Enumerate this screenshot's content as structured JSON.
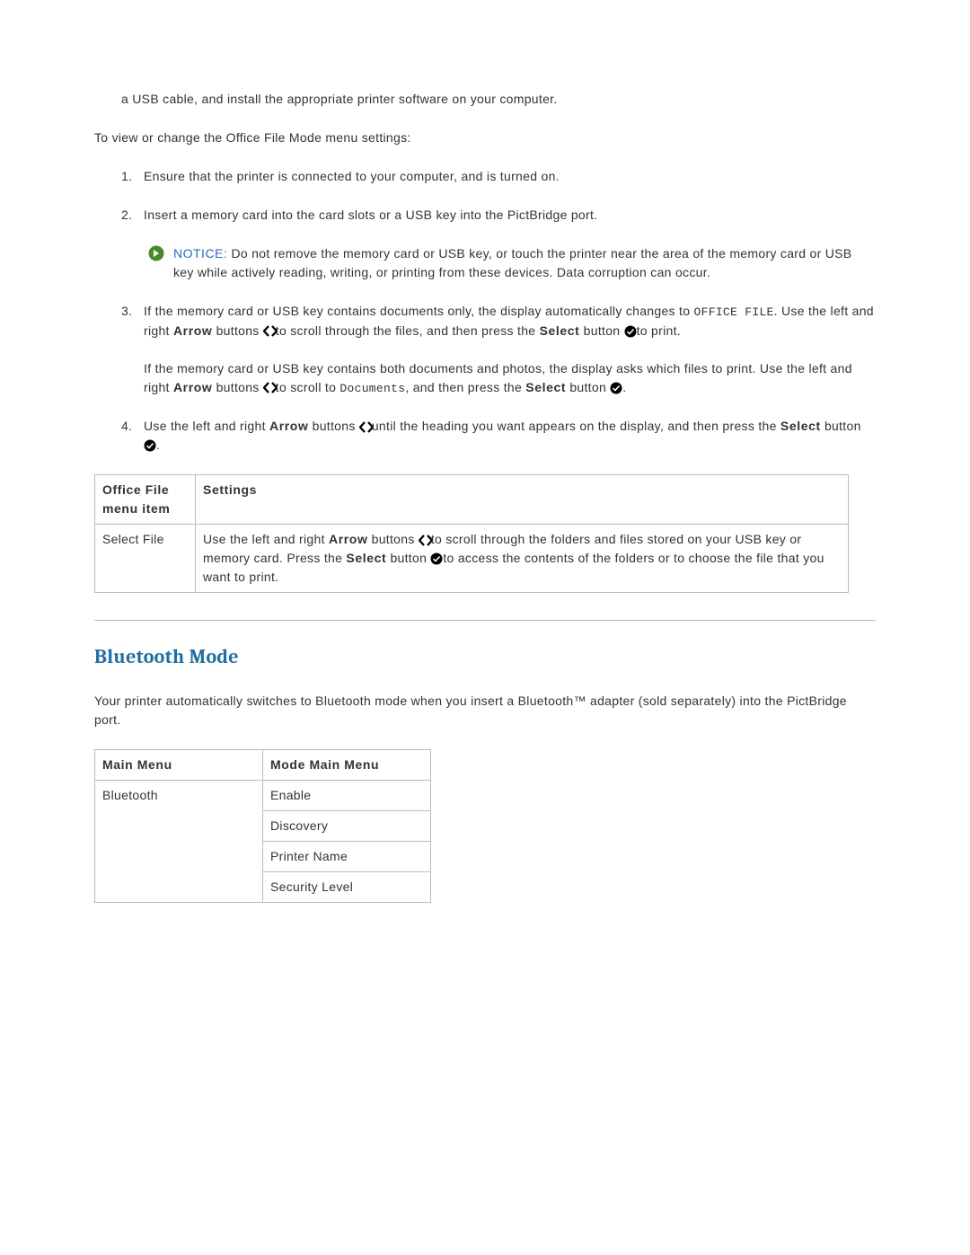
{
  "intro_line": "a USB cable, and install the appropriate printer software on your computer.",
  "instructions_intro": "To view or change the Office File Mode menu settings:",
  "steps": {
    "s1": {
      "num": "1.",
      "text": "Ensure that the printer is connected to your computer, and is turned on."
    },
    "s2": {
      "num": "2.",
      "text": "Insert a memory card into the card slots or a USB key into the PictBridge port."
    },
    "notice": {
      "label": "NOTICE:",
      "text": "Do not remove the memory card or USB key, or touch the printer near the area of the memory card or USB key while actively reading, writing, or printing from these devices. Data corruption can occur."
    },
    "s3": {
      "num": "3.",
      "p1a": "If the memory card or USB key contains documents only, the display automatically changes to ",
      "p1_mono": "OFFICE FILE",
      "p1b": ". Use the left and right ",
      "arrow_label1": "Arrow",
      "p1c": " buttons ",
      "p1d": "to scroll through the files, and then press the ",
      "select_label1": "Select",
      "p1e": " button ",
      "p1f": "to print.",
      "p2a": "If the memory card or USB key contains both documents and photos, the display asks which files to print. Use the left and right ",
      "arrow_label2": "Arrow",
      "p2b": " buttons ",
      "p2c": "to scroll to ",
      "p2_mono": "Documents",
      "p2d": ", and then press the ",
      "select_label2": "Select",
      "p2e": " button ",
      "p2f": "."
    },
    "s4": {
      "num": "4.",
      "a": "Use the left and right ",
      "arrow_label": "Arrow",
      "b": " buttons ",
      "c": "until the heading you want appears on the display, and then press the ",
      "select_label": "Select",
      "d": " button ",
      "e": "."
    }
  },
  "office_table": {
    "header": {
      "c1": "Office File menu item",
      "c2": "Settings"
    },
    "row": {
      "c1": "Select File",
      "a": "Use the left and right ",
      "arrow_label": "Arrow",
      "b": " buttons ",
      "c": "to scroll through the folders and files stored on your USB key or memory card. Press the ",
      "select_label": "Select",
      "d": " button ",
      "e": "to access the contents of the folders or to choose the file that you want to print."
    }
  },
  "section_heading": "Bluetooth Mode",
  "bt_intro": "Your printer automatically switches to Bluetooth mode when you insert a Bluetooth™ adapter (sold separately) into the PictBridge port.",
  "bt_table": {
    "header": {
      "c1": "Main Menu",
      "c2": "Mode Main Menu"
    },
    "row_label": "Bluetooth",
    "rows": [
      "Enable",
      "Discovery",
      "Printer Name",
      "Security Level"
    ]
  }
}
